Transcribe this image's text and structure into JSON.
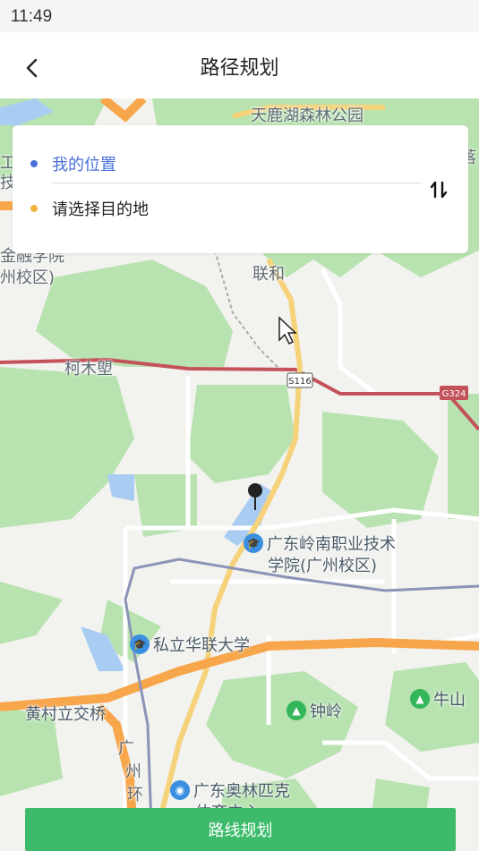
{
  "status_bar": {
    "time": "11:49"
  },
  "header": {
    "title": "路径规划"
  },
  "route": {
    "start_label": "我的位置",
    "destination_placeholder": "请选择目的地",
    "start_dot_color": "#4a6fd8",
    "dest_dot_color": "#f0b43c",
    "start_text_color": "#4a6fd8"
  },
  "map": {
    "labels": {
      "park": "天鹿湖森林公园",
      "lianhe": "联和",
      "kemutang": "柯木塱",
      "road_s116": "S116",
      "road_g324": "G324",
      "finance_1": "金融学院",
      "finance_2": "州校区)",
      "left_top_1": "工",
      "left_top_2": "技",
      "right_top": "落",
      "lingnan_1": "广东岭南职业技术",
      "lingnan_2": "学院(广州校区)",
      "hualian": "私立华联大学",
      "huangcun": "黄村立交桥",
      "zhongling": "钟岭",
      "niushan": "牛山",
      "olympic_1": "广东奥林匹克",
      "olympic_2": "体育中心",
      "ring_1": "广",
      "ring_2": "州",
      "ring_3": "环"
    }
  },
  "actions": {
    "plan_label": "路线规划"
  },
  "colors": {
    "green_area": "#b8e3b0",
    "road_major": "#f7a64b",
    "road_yellow": "#f6d27a",
    "road_red": "#c4525a",
    "rail": "#8b93b7",
    "water": "#a9cdf2",
    "button": "#3dbb6a"
  }
}
